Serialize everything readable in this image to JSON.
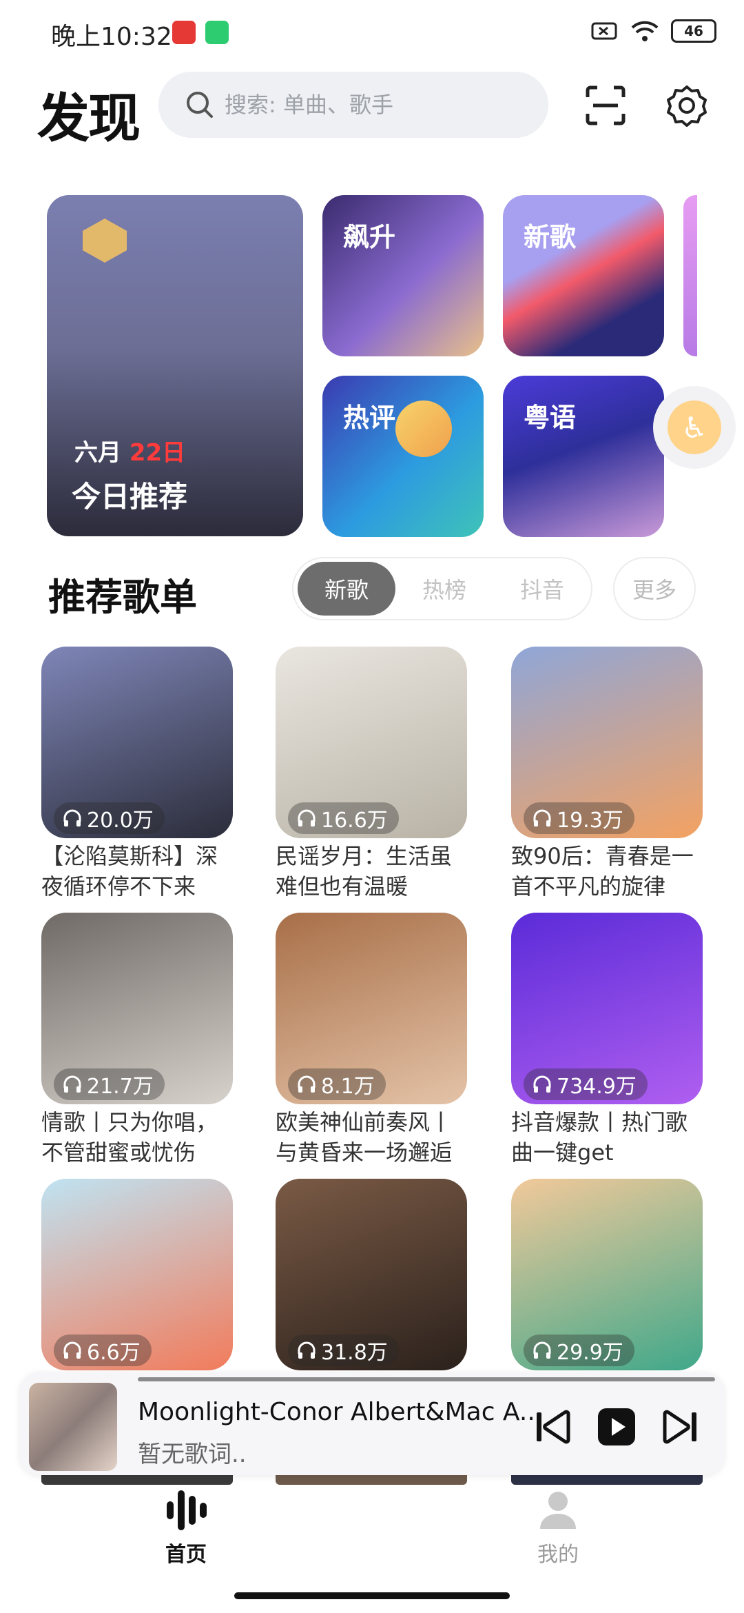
{
  "status_bar": {
    "time": "晚上10:32",
    "battery": "46"
  },
  "header": {
    "title": "发现",
    "search_placeholder": "搜索: 单曲、歌手"
  },
  "tiles": {
    "today": {
      "month": "六月",
      "day": "22日",
      "title": "今日推荐"
    },
    "items": [
      {
        "label": "飙升"
      },
      {
        "label": "新歌"
      },
      {
        "label": "热评"
      },
      {
        "label": "粤语"
      }
    ]
  },
  "section": {
    "title": "推荐歌单",
    "tabs": [
      {
        "label": "新歌",
        "active": true
      },
      {
        "label": "热榜",
        "active": false
      },
      {
        "label": "抖音",
        "active": false
      }
    ],
    "more": "更多"
  },
  "playlists": [
    {
      "plays": "20.0万",
      "title": "【沦陷莫斯科】深夜循环停不下来",
      "colors": [
        "#7f86b8",
        "#2b2d3a"
      ]
    },
    {
      "plays": "16.6万",
      "title": "民谣岁月：生活虽难但也有温暖",
      "colors": [
        "#e9e6e0",
        "#b9b3a6"
      ]
    },
    {
      "plays": "19.3万",
      "title": "致90后：青春是一首不平凡的旋律",
      "colors": [
        "#8fa6d8",
        "#f4a261"
      ]
    },
    {
      "plays": "21.7万",
      "title": "情歌丨只为你唱，不管甜蜜或忧伤",
      "colors": [
        "#6f6a66",
        "#d8d2cc"
      ]
    },
    {
      "plays": "8.1万",
      "title": "欧美神仙前奏风丨与黄昏来一场邂逅",
      "colors": [
        "#a86f48",
        "#e4c3a8"
      ]
    },
    {
      "plays": "734.9万",
      "title": "抖音爆款丨热门歌曲一键get",
      "colors": [
        "#5b2bd8",
        "#b05ff0"
      ]
    },
    {
      "plays": "6.6万",
      "title": "",
      "colors": [
        "#bfe3f2",
        "#f27b5b"
      ]
    },
    {
      "plays": "31.8万",
      "title": "",
      "colors": [
        "#7a5a45",
        "#2b211c"
      ]
    },
    {
      "plays": "29.9万",
      "title": "",
      "colors": [
        "#f2c99a",
        "#3fa88a"
      ]
    }
  ],
  "player": {
    "song": "Moonlight-Conor Albert&Mac A...",
    "lyric": "暂无歌词..",
    "progress": 1.0
  },
  "nav": [
    {
      "label": "首页",
      "icon": "bars-icon",
      "active": true
    },
    {
      "label": "我的",
      "icon": "person-icon",
      "active": false
    }
  ]
}
